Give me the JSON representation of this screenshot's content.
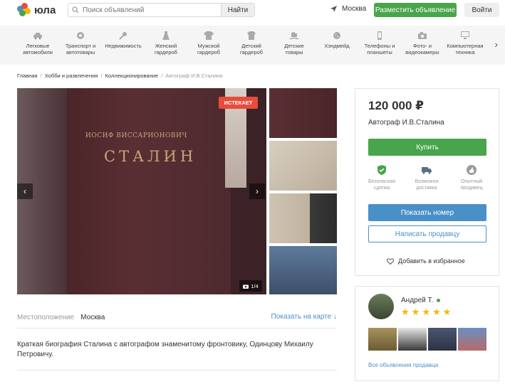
{
  "header": {
    "logo_text": "юла",
    "search_placeholder": "Поиск объявлений",
    "search_button": "Найти",
    "city": "Москва",
    "place_ad_button": "Разместить объявление",
    "login_button": "Войти"
  },
  "categories": [
    {
      "line1": "Легковые",
      "line2": "автомобили",
      "icon": "car-icon"
    },
    {
      "line1": "Транспорт и",
      "line2": "автотовары",
      "icon": "wheel-icon"
    },
    {
      "line1": "Недвижимость",
      "line2": "",
      "icon": "key-icon"
    },
    {
      "line1": "Женский",
      "line2": "гардероб",
      "icon": "dress-icon"
    },
    {
      "line1": "Мужской",
      "line2": "гардероб",
      "icon": "shirt-icon"
    },
    {
      "line1": "Детский",
      "line2": "гардероб",
      "icon": "kids-clothes-icon"
    },
    {
      "line1": "Детские",
      "line2": "товары",
      "icon": "rocking-horse-icon"
    },
    {
      "line1": "Хэндмейд",
      "line2": "",
      "icon": "button-icon"
    },
    {
      "line1": "Телефоны и",
      "line2": "планшеты",
      "icon": "phone-icon"
    },
    {
      "line1": "Фото- и",
      "line2": "видеокамеры",
      "icon": "camera-icon"
    },
    {
      "line1": "Компьютерная",
      "line2": "техника",
      "icon": "monitor-icon"
    }
  ],
  "breadcrumbs": {
    "home": "Главная",
    "section": "Хобби и развлечения",
    "subsection": "Коллекционирование",
    "current": "Автограф И.В.Сталина",
    "separator": "/"
  },
  "gallery": {
    "badge": "ИСТЕКАЕТ",
    "counter": "1/4",
    "book_author": "ИОСИФ ВИССАРИОНОВИЧ",
    "book_title": "СТАЛИН"
  },
  "location": {
    "label": "Местоположение",
    "value": "Москва",
    "map_link": "Показать на карте ↓"
  },
  "description": "Краткая биография Сталина с автографом знаменитому фронтовику, Одинцову Михаилу Петровичу.",
  "offer": {
    "price": "120 000 ₽",
    "title": "Автограф И.В.Сталина",
    "buy_button": "Купить",
    "features": [
      {
        "line1": "Безопасная",
        "line2": "сделка",
        "icon": "shield-check-icon",
        "color": "#48a54b"
      },
      {
        "line1": "Возможна",
        "line2": "доставка",
        "icon": "truck-icon",
        "color": "#5a6f86"
      },
      {
        "line1": "Опытный",
        "line2": "продавец",
        "icon": "thumbs-up-icon",
        "color": "#9a9a9a"
      }
    ],
    "phone_button": "Показать номер",
    "message_button": "Написать продавцу",
    "favorite": "Добавить в избранное"
  },
  "seller": {
    "name": "Андрей Т.",
    "rating": 5,
    "all_ads_link": "Все объявления продавца"
  },
  "colors": {
    "green": "#48a54b",
    "blue": "#4a90c8",
    "badge_red": "#e74c3c",
    "star": "#f5b800"
  }
}
